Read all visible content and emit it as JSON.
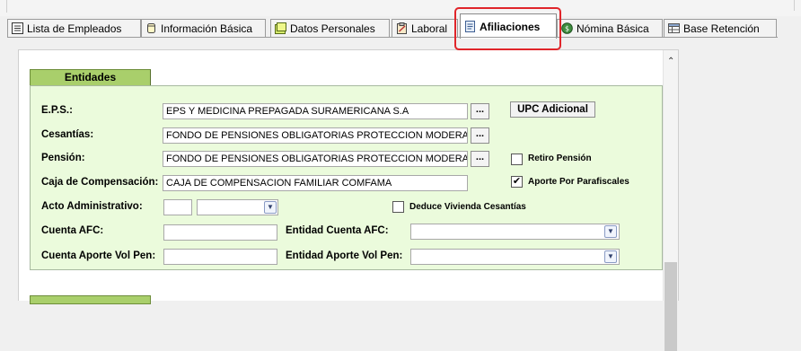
{
  "tabs": [
    {
      "label": "Lista de Empleados",
      "icon": "list-icon"
    },
    {
      "label": "Información Básica",
      "icon": "cylinder-icon"
    },
    {
      "label": "Datos Personales",
      "icon": "note-icon"
    },
    {
      "label": "Laboral",
      "icon": "clipboard-icon"
    },
    {
      "label": "Afiliaciones",
      "icon": "document-icon",
      "active": true
    },
    {
      "label": "Nómina Básica",
      "icon": "money-icon"
    },
    {
      "label": "Base Retención",
      "icon": "table-icon"
    }
  ],
  "section": {
    "title": "Entidades"
  },
  "form": {
    "eps": {
      "label": "E.P.S.:",
      "value": "EPS Y MEDICINA PREPAGADA SURAMERICANA S.A",
      "button": "..."
    },
    "cesantias": {
      "label": "Cesantías:",
      "value": "FONDO DE PENSIONES OBLIGATORIAS PROTECCION MODERADO",
      "button": "..."
    },
    "pension": {
      "label": "Pensión:",
      "value": "FONDO DE PENSIONES OBLIGATORIAS PROTECCION MODERADO",
      "button": "..."
    },
    "caja": {
      "label": "Caja de Compensación:",
      "value": "CAJA DE COMPENSACION FAMILIAR COMFAMA"
    },
    "acto": {
      "label": "Acto Administrativo:",
      "value": "",
      "select_value": ""
    },
    "cuenta_afc": {
      "label": "Cuenta AFC:",
      "value": ""
    },
    "entidad_afc": {
      "label": "Entidad Cuenta AFC:",
      "value": ""
    },
    "cuenta_vol": {
      "label": "Cuenta Aporte Vol Pen:",
      "value": ""
    },
    "entidad_vol": {
      "label": "Entidad Aporte Vol Pen:",
      "value": ""
    },
    "upc_button": "UPC Adicional",
    "retiro_pension": {
      "label": "Retiro Pensión",
      "checked": false
    },
    "aporte_parafiscales": {
      "label": "Aporte Por Parafiscales",
      "checked": true
    },
    "deduce_vivienda": {
      "label": "Deduce Vivienda Cesantías",
      "checked": false
    }
  },
  "colors": {
    "section_header": "#a9cf6b",
    "section_bg": "#ebfbdc",
    "highlight": "#e0252a"
  }
}
